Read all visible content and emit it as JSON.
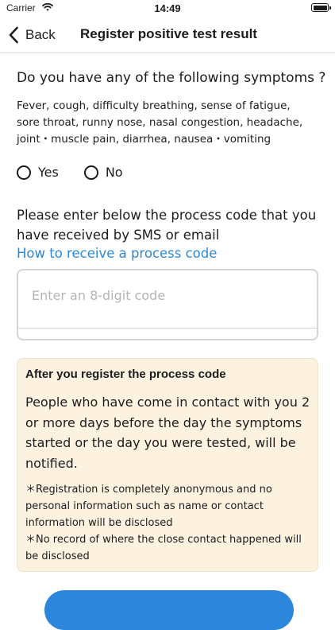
{
  "status_bar": {
    "carrier": "Carrier",
    "time": "14:49",
    "wifi_icon": "wifi-icon",
    "battery_icon": "battery-icon"
  },
  "nav": {
    "back_label": "Back",
    "back_icon": "chevron-left-icon",
    "title": "Register positive test result"
  },
  "symptoms": {
    "question": "Do you have any of the following symptoms ?",
    "list": "Fever, cough, difficulty breathing, sense of fatigue, sore throat, runny nose, nasal congestion, headache, joint・muscle pain, diarrhea, nausea・vomiting",
    "options": [
      {
        "label": "Yes",
        "selected": false
      },
      {
        "label": "No",
        "selected": false
      }
    ]
  },
  "process_code": {
    "prompt": "Please enter below the process code that you have received by SMS or email",
    "help_link": "How to receive a process code",
    "placeholder": "Enter an 8-digit code",
    "value": ""
  },
  "info": {
    "title": "After you register the process code",
    "body": "People who have come in contact with you 2 or more days before the day the symptoms started or the day you were tested, will be notified.",
    "note_1": "＊Registration is completely anonymous and no personal information such as name or contact information will be disclosed",
    "note_2": "＊No record of where the close contact happened will be disclosed"
  },
  "colors": {
    "accent": "#2a8ad8",
    "button": "#2c86dc",
    "info_background": "#fdf2e0"
  }
}
